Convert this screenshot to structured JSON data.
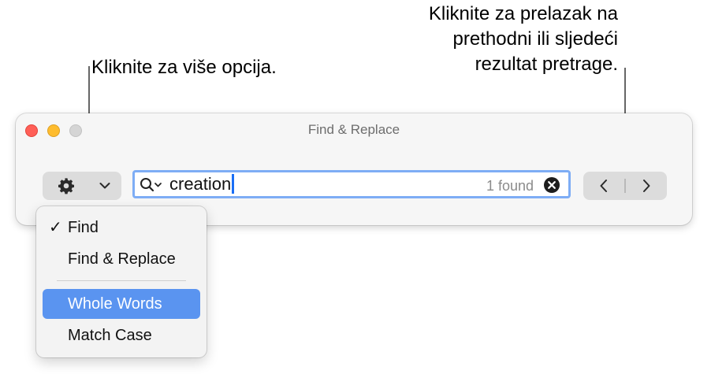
{
  "callouts": {
    "options": "Kliknite za više opcija.",
    "navigation_lines": [
      "Kliknite za prelazak na",
      "prethodni ili sljedeći",
      "rezultat pretrage."
    ]
  },
  "window": {
    "title": "Find & Replace"
  },
  "search": {
    "query": "creation",
    "result_count": "1 found"
  },
  "menu": {
    "items": [
      {
        "label": "Find",
        "checked": "✓"
      },
      {
        "label": "Find & Replace"
      },
      {
        "label": "Whole Words",
        "highlighted": true
      },
      {
        "label": "Match Case"
      }
    ]
  },
  "icons": {
    "options": "gear-icon",
    "options_dropdown": "chevron-down-icon",
    "search": "magnifier-icon",
    "clear": "clear-circle-icon",
    "previous": "chevron-left-icon",
    "next": "chevron-right-icon"
  },
  "colors": {
    "focus_ring": "#7eadf5",
    "menu_highlight": "#5a94f0",
    "caret": "#1a6ef5",
    "close": "#ff5f57",
    "minimize": "#febc2e",
    "zoom": "#d5d5d5"
  }
}
